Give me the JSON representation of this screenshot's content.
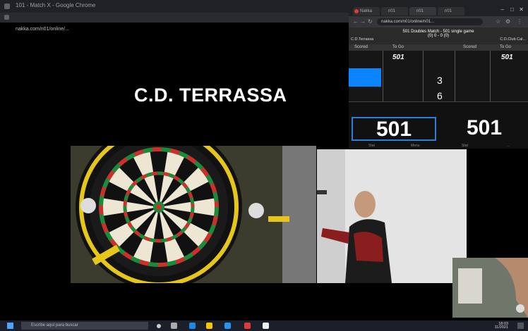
{
  "browser_main": {
    "title": "101 - Match X - Google Chrome",
    "url": "nakka.com/n01/online/..."
  },
  "club": {
    "name": "C.D. TERRASSA"
  },
  "popup": {
    "tabs": [
      "Nakka",
      "n01",
      "n01",
      "n01"
    ],
    "url": "nakka.com/n01/online/n01...",
    "match_title": "501 Doubles Match - 501 single game",
    "match_score": "(0) 0 - 0 (0)",
    "player_left": "C.D.Terrassa",
    "player_right": "C.D.Club Cal...",
    "col_scored_left": "Scored",
    "col_togo_left": "To Go",
    "col_scored_right": "Scored",
    "col_togo_right": "To Go",
    "togo_left": "501",
    "togo_right": "501",
    "darts_1": "3",
    "darts_2": "6",
    "score_left": "501",
    "score_right": "501",
    "footer": [
      "Stat",
      "Menu",
      "Stat",
      "..."
    ]
  },
  "taskbar": {
    "search_placeholder": "Escribe aquí para buscar",
    "time": "18:03",
    "date": "11/2021"
  },
  "colors": {
    "accent": "#0a84ff",
    "active_border": "#2b7fd8"
  }
}
